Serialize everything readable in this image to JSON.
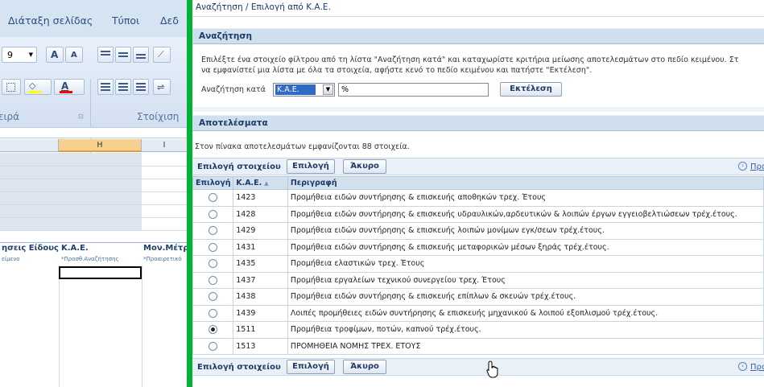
{
  "excel": {
    "tabs": [
      "Διάταξη σελίδας",
      "Τύποι",
      "Δεδ"
    ],
    "font_size": "9",
    "font_grow_label": "A",
    "font_shrink_label": "A",
    "font_color_label": "A",
    "group_font": "ειρά",
    "group_align": "Στοίχιση",
    "col_h": "H",
    "col_i": "I",
    "header_eidous": "ησεις Είδους",
    "header_kae": "Κ.Α.Ε.",
    "header_mon": "Μον.Μέτρ",
    "sub_eidous": "είμενο",
    "sub_kae": "*Προσθ.Αναζήτησης",
    "sub_mon": "*Προαιρετικό"
  },
  "popup": {
    "title": "Αναζήτηση / Επιλογή από Κ.Α.Ε.",
    "search": {
      "header": "Αναζήτηση",
      "instruction_line1": "Επιλέξτε ένα στοιχείο φίλτρου από τη λίστα \"Αναζήτηση κατά\" και καταχωρίστε κριτήρια μείωσης αποτελεσμάτων στο πεδίο κειμένου. Στ",
      "instruction_line2": "να εμφανίστεί μια λίστα με όλα τα στοιχεία, αφήστε κενό το πεδίο κειμένου και πατήστε \"Εκτέλεση\".",
      "search_by_label": "Αναζήτηση κατά",
      "search_by_value": "Κ.Α.Ε.",
      "input_value": "%",
      "go_button": "Εκτέλεση"
    },
    "results": {
      "header": "Αποτελέσματα",
      "count_text": "Στον πίνακα αποτελεσμάτων εμφανίζονται 88 στοιχεία.",
      "select_label": "Επιλογή στοιχείου",
      "select_button": "Επιλογή",
      "cancel_button": "Άκυρο",
      "prev_link": "Προ",
      "columns": [
        "Επιλογή",
        "Κ.Α.Ε.",
        "Περιγραφή"
      ],
      "rows": [
        {
          "code": "1423",
          "desc": "Προμήθεια ειδών συντήρησης & επισκευής αποθηκών τρεχ. Έτους",
          "selected": false
        },
        {
          "code": "1428",
          "desc": "Προμήθεια ειδών συντήρησης & επισκευής υδραυλικών,αρδευτικών & λοιπών έργων εγγειοβελτιώσεων τρέχ.έτους.",
          "selected": false
        },
        {
          "code": "1429",
          "desc": "Προμήθεια ειδών συντήρησης & επισκευής λοιπών μονίμων εγκ/σεων τρέχ.έτους.",
          "selected": false
        },
        {
          "code": "1431",
          "desc": "Προμήθεια ειδών συντήρησης & επισκευής μεταφορικών μέσων ξηράς τρέχ.έτους.",
          "selected": false
        },
        {
          "code": "1435",
          "desc": "Προμήθεια ελαστικών τρεχ. Έτους",
          "selected": false
        },
        {
          "code": "1437",
          "desc": "Προμήθεια εργαλείων τεχνικού συνεργείου τρεχ. Έτους",
          "selected": false
        },
        {
          "code": "1438",
          "desc": "Προμήθεια ειδών συντήρησης & επισκευής επίπλων & σκευών τρέχ.έτους.",
          "selected": false
        },
        {
          "code": "1439",
          "desc": "Λοιπές προμήθειες ειδών συντήρησης & επισκευής μηχανικού & λοιπού εξοπλισμού τρέχ.έτους.",
          "selected": false
        },
        {
          "code": "1511",
          "desc": "Προμήθεια τροφίμων, ποτών, καπνού τρέχ.έτους.",
          "selected": true
        },
        {
          "code": "1513",
          "desc": "ΠΡΟΜΗΘΕΙΑ ΝΟΜΗΣ ΤΡΕΧ. ΕΤΟΥΣ",
          "selected": false
        }
      ]
    }
  },
  "colors": {
    "accent_green": "#00b336",
    "header_bg": "#cfdfee",
    "selection_blue": "#316ac5"
  }
}
